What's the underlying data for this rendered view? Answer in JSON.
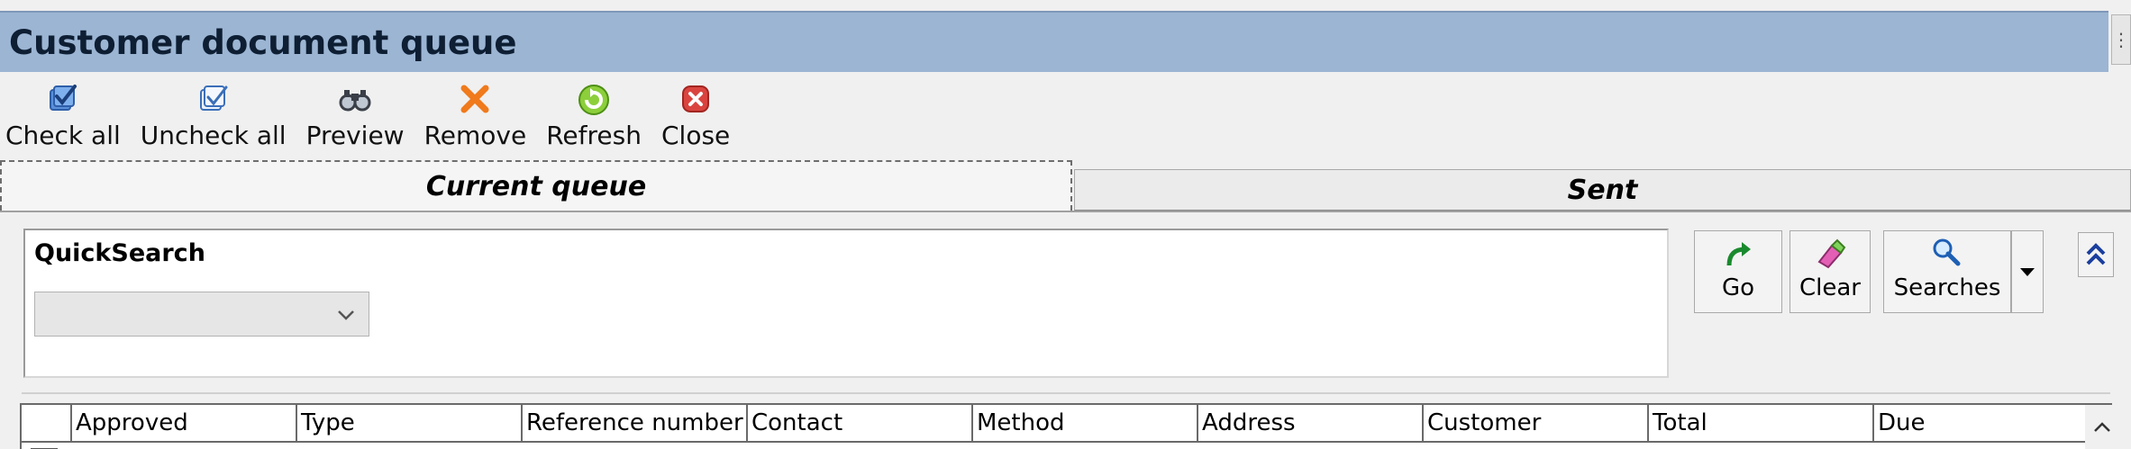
{
  "window": {
    "title": "Customer document queue"
  },
  "toolbar": {
    "items": [
      {
        "label": "Check all",
        "icon": "check-all-icon"
      },
      {
        "label": "Uncheck all",
        "icon": "uncheck-all-icon"
      },
      {
        "label": "Preview",
        "icon": "binoculars-icon"
      },
      {
        "label": "Remove",
        "icon": "remove-x-icon"
      },
      {
        "label": "Refresh",
        "icon": "refresh-icon"
      },
      {
        "label": "Close",
        "icon": "close-icon"
      }
    ]
  },
  "tabs": [
    {
      "label": "Current queue",
      "active": true
    },
    {
      "label": "Sent",
      "active": false
    }
  ],
  "quicksearch": {
    "label": "QuickSearch",
    "selected_value": ""
  },
  "search_buttons": {
    "go": "Go",
    "clear": "Clear",
    "searches": "Searches"
  },
  "grid": {
    "columns": [
      "Approved",
      "Type",
      "Reference number",
      "Contact",
      "Method",
      "Address",
      "Customer",
      "Total",
      "Due"
    ]
  },
  "colors": {
    "title_bar": "#9bb5d3",
    "title_text": "#0e1e33"
  }
}
